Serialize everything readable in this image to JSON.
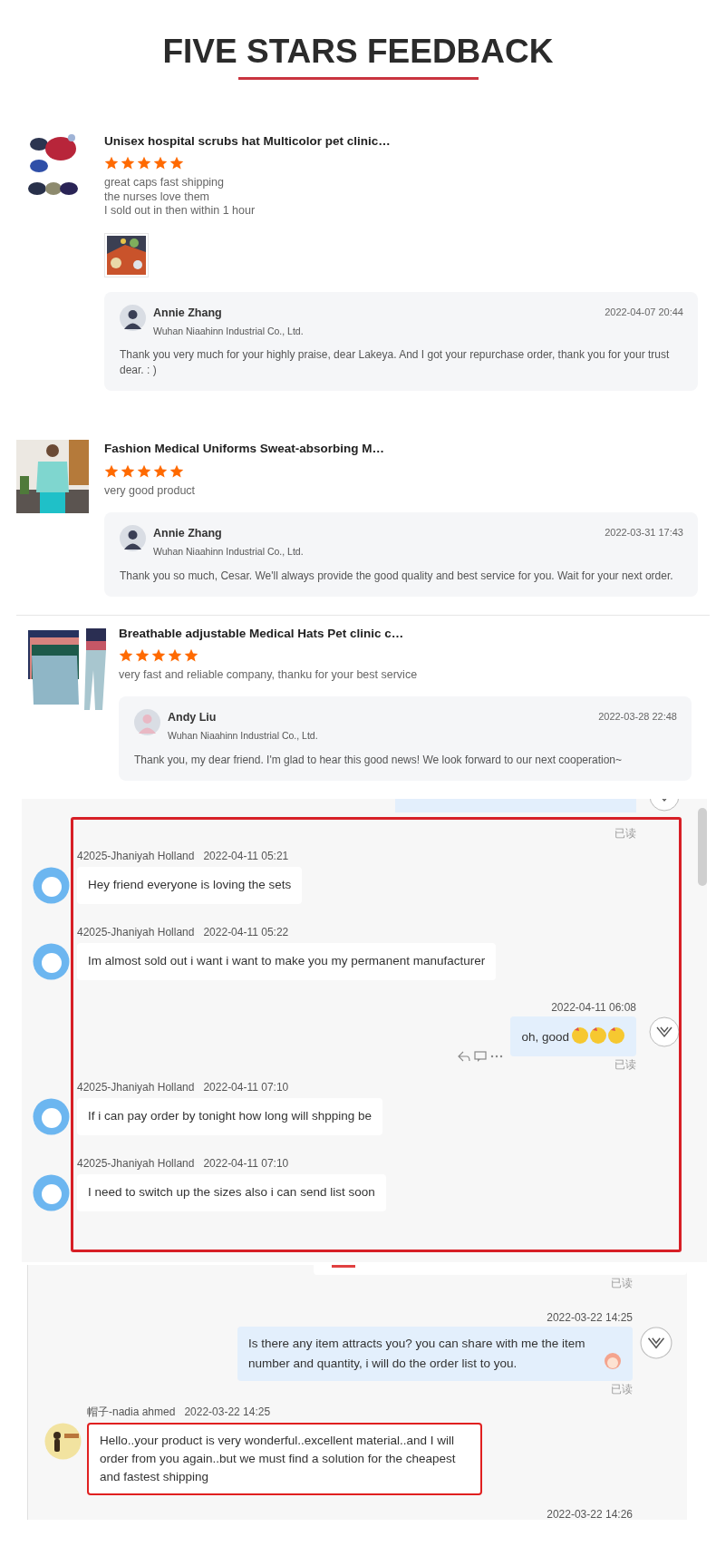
{
  "title": "FIVE STARS FEEDBACK",
  "reviews": [
    {
      "product": "Unisex hospital scrubs hat Multicolor pet clinic…",
      "stars": 5,
      "comment": [
        "great caps fast shipping",
        "the nurses love them",
        "I sold out in then within 1 hour"
      ],
      "photos": [
        {
          "kind": "picture"
        }
      ],
      "separated": false,
      "reply": {
        "name": "Annie Zhang",
        "company": "Wuhan Niaahinn Industrial Co., Ltd.",
        "time": "2022-04-07 20:44",
        "text": "Thank you very much for your highly praise, dear Lakeya. And I got your repurchase order, thank you for your trust dear. :  )"
      }
    },
    {
      "product": "Fashion Medical Uniforms Sweat-absorbing M…",
      "stars": 5,
      "comment": [
        "very good product"
      ],
      "separated": false,
      "reply": {
        "name": "Annie Zhang",
        "company": "Wuhan Niaahinn Industrial Co., Ltd.",
        "time": "2022-03-31 17:43",
        "text": "Thank you so much, Cesar. We'll always provide the good quality and best service for you. Wait for your next order."
      }
    },
    {
      "product": "Breathable adjustable Medical Hats Pet clinic c…",
      "stars": 5,
      "comment": [
        "very fast and reliable company, thanku for your best service"
      ],
      "separated": true,
      "reply": {
        "name": "Andy Liu",
        "company": "Wuhan Niaahinn Industrial Co., Ltd.",
        "time": "2022-03-28 22:48",
        "text": "Thank you, my dear friend. I'm glad to hear this good news! We look forward to our next cooperation~"
      }
    }
  ],
  "chats": [
    {
      "top_fragment": {
        "kind": "bubble"
      },
      "highlighted": true,
      "scrollbar": true,
      "items": [
        {
          "kind": "read_status",
          "text": "已读"
        },
        {
          "kind": "incoming",
          "sender": "42025-Jhaniyah Holland",
          "time": "2022-04-11 05:21",
          "text": "Hey friend everyone is loving the sets",
          "highlighted": false
        },
        {
          "kind": "incoming",
          "sender": "42025-Jhaniyah Holland",
          "time": "2022-04-11 05:22",
          "text": "Im almost sold out i want i want to make you my permanent manufacturer",
          "highlighted": false
        },
        {
          "kind": "outgoing",
          "time": "2022-04-11 06:08",
          "text": "oh, good",
          "sticker": {
            "kind": "emoji_row"
          },
          "actions": true
        },
        {
          "kind": "read_status",
          "text": "已读"
        },
        {
          "kind": "incoming",
          "sender": "42025-Jhaniyah Holland",
          "time": "2022-04-11 07:10",
          "text": "If i can pay order by tonight how long will shpping be",
          "highlighted": false
        },
        {
          "kind": "incoming",
          "sender": "42025-Jhaniyah Holland",
          "time": "2022-04-11 07:10",
          "text": "I need to switch up the sizes also i can send list soon",
          "highlighted": false
        }
      ]
    },
    {
      "top_fragment": {
        "kind": "card"
      },
      "highlighted": false,
      "scrollbar": false,
      "items": [
        {
          "kind": "read_status",
          "text": "已读"
        },
        {
          "kind": "outgoing",
          "time": "2022-03-22 14:25",
          "text": "Is there any item attracts you? you can share with me the item number and quantity, i will do the order list to you.",
          "sticker": {
            "kind": "girl"
          },
          "actions": false
        },
        {
          "kind": "read_status",
          "text": "已读"
        },
        {
          "kind": "incoming",
          "sender": "帽子-nadia ahmed",
          "time": "2022-03-22 14:25",
          "text": "Hello..your product is very wonderful..excellent material..and I will order from you again..but we must find a solution for the cheapest and fastest shipping",
          "highlighted": true
        },
        {
          "kind": "timestamp",
          "text": "2022-03-22 14:26"
        }
      ]
    }
  ]
}
